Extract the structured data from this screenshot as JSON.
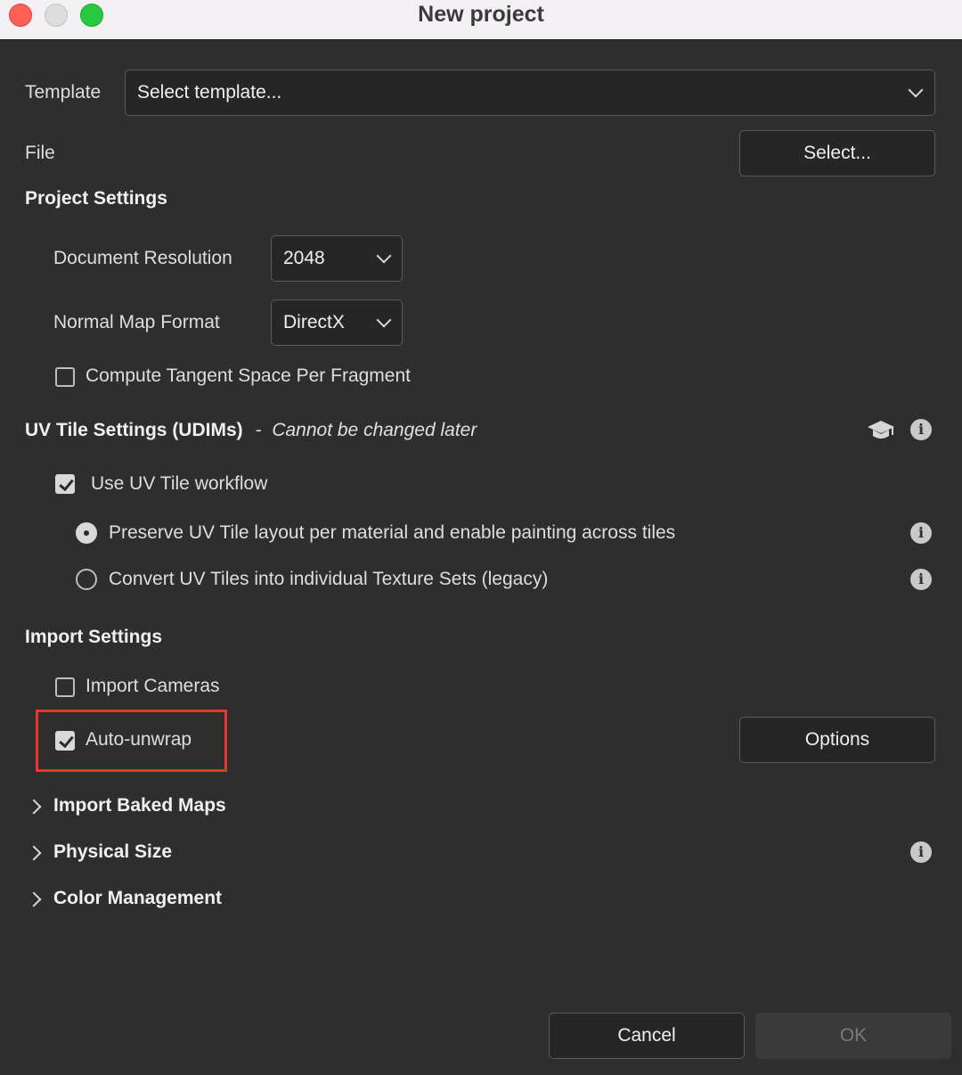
{
  "window": {
    "title": "New project"
  },
  "template": {
    "label": "Template",
    "value": "Select template..."
  },
  "file": {
    "label": "File",
    "button": "Select..."
  },
  "project_settings": {
    "heading": "Project Settings",
    "resolution_label": "Document Resolution",
    "resolution_value": "2048",
    "normal_label": "Normal Map Format",
    "normal_value": "DirectX",
    "tangent_label": "Compute Tangent Space Per Fragment",
    "tangent_checked": false
  },
  "uv_tiles": {
    "heading": "UV Tile Settings (UDIMs)",
    "separator": "-",
    "note": "Cannot be changed later",
    "workflow_label": "Use UV Tile workflow",
    "workflow_checked": true,
    "option_preserve": "Preserve UV Tile layout per material and enable painting across tiles",
    "option_convert": "Convert UV Tiles into individual Texture Sets (legacy)",
    "selected_option": "preserve"
  },
  "import_settings": {
    "heading": "Import Settings",
    "cameras_label": "Import Cameras",
    "cameras_checked": false,
    "unwrap_label": "Auto-unwrap",
    "unwrap_checked": true,
    "options_button": "Options"
  },
  "collapsibles": {
    "baked_maps": "Import Baked Maps",
    "physical_size": "Physical Size",
    "color_management": "Color Management"
  },
  "footer": {
    "cancel": "Cancel",
    "ok": "OK"
  },
  "icons": {
    "info": "info-icon",
    "learn": "graduation-cap-icon"
  },
  "colors": {
    "highlight": "#e8362a",
    "background": "#2e2e2e"
  }
}
